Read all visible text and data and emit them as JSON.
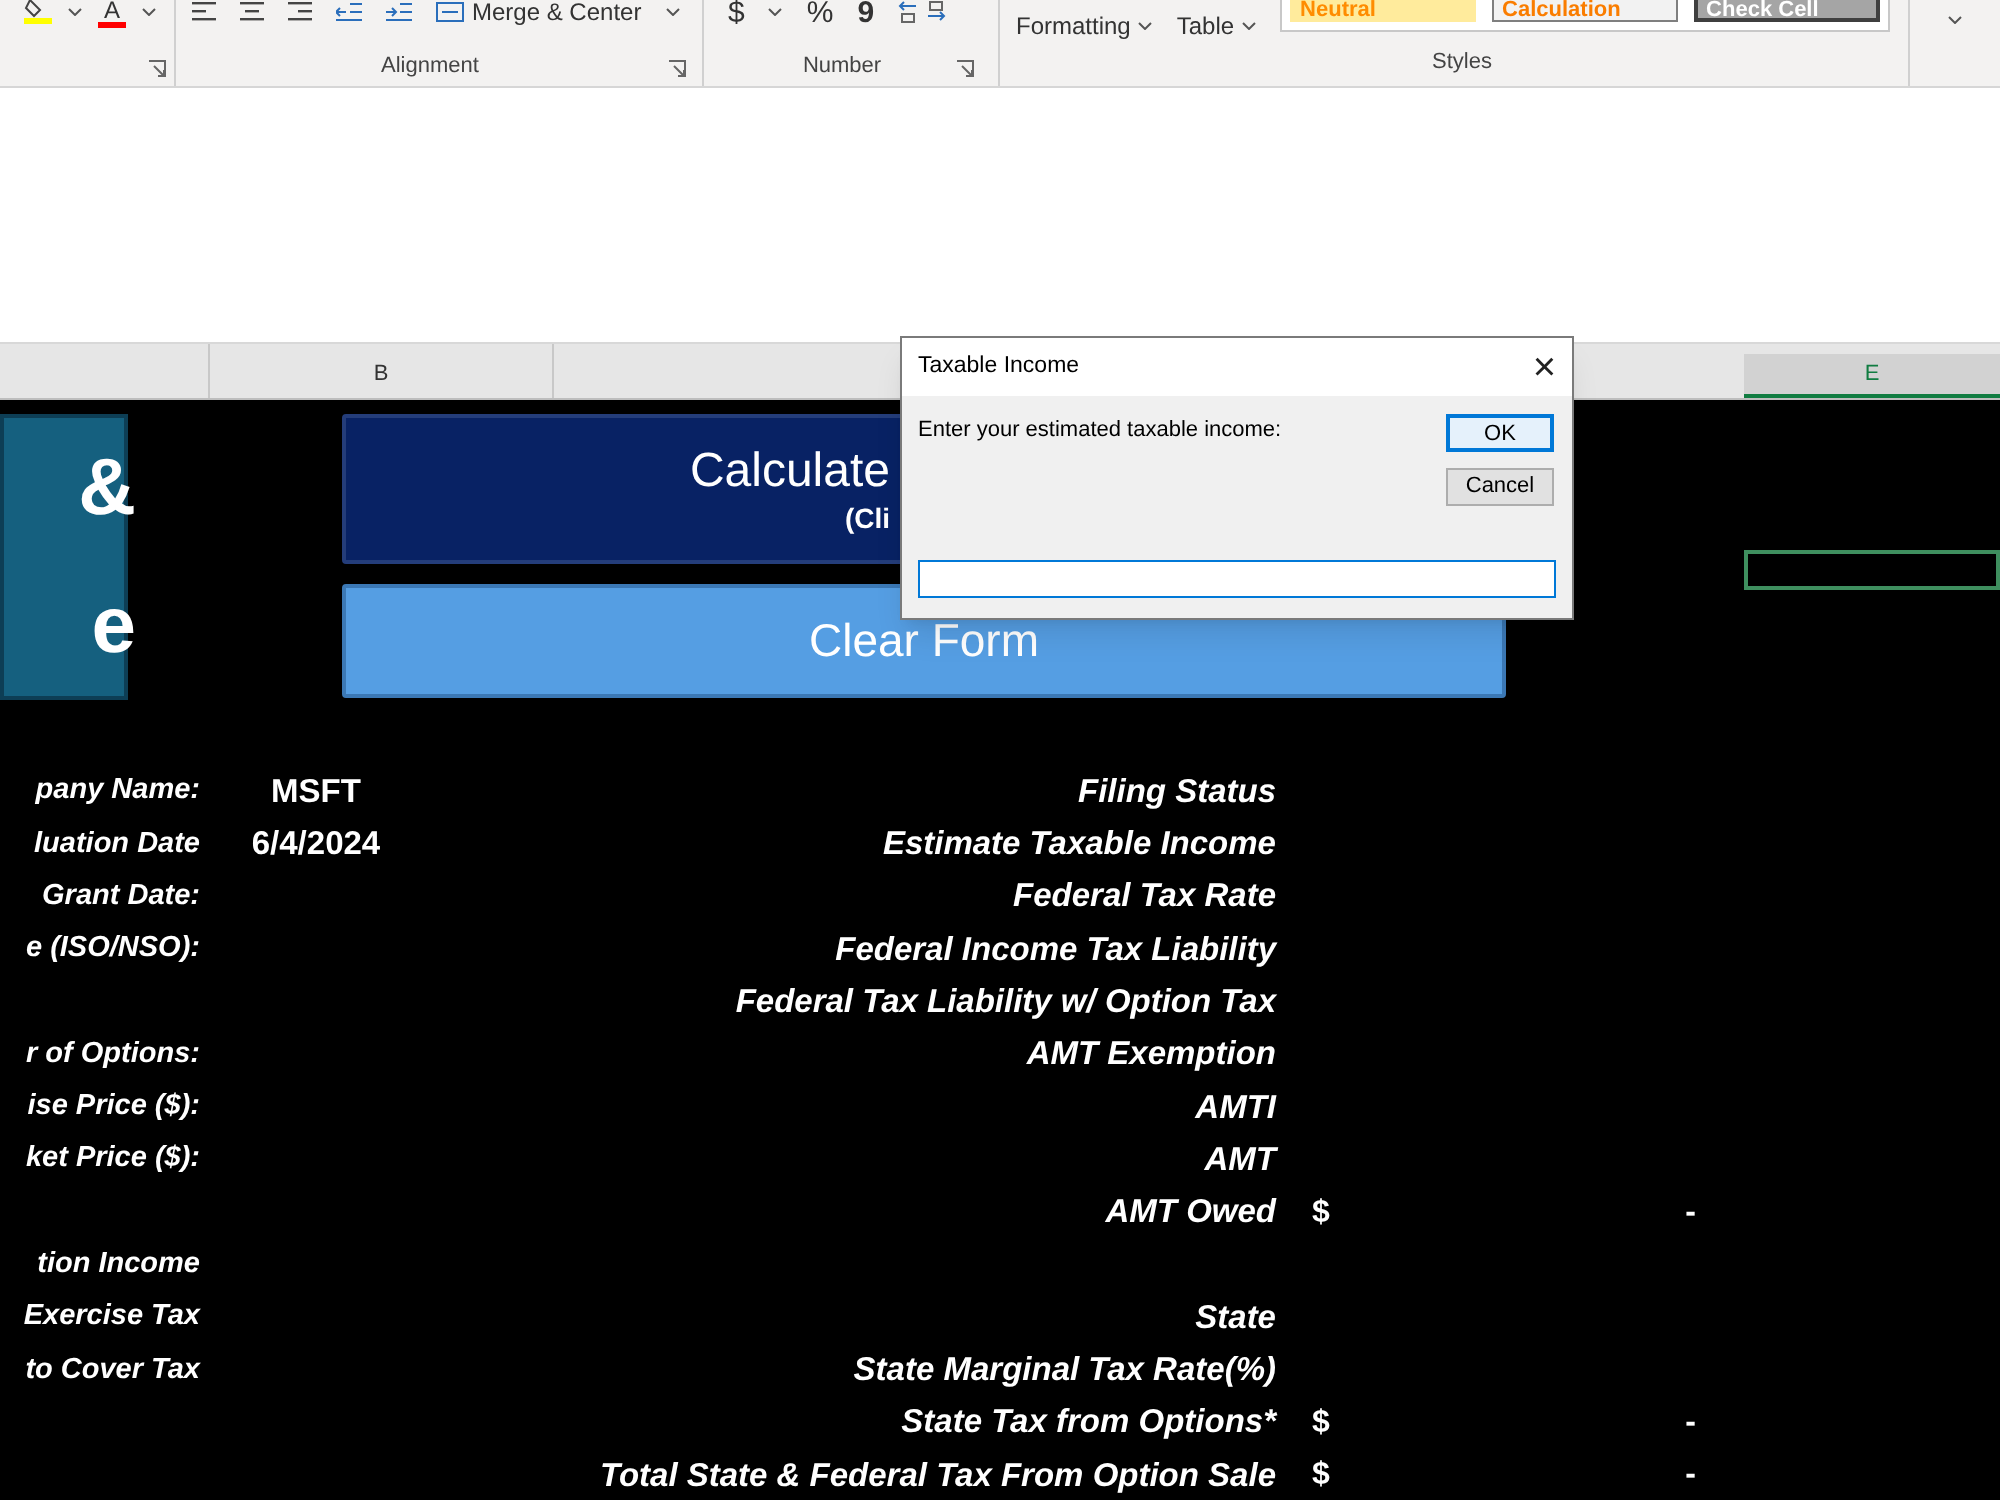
{
  "ribbon": {
    "font_color_letter": "A",
    "merge_button": "Merge & Center",
    "number_symbols": [
      "$",
      "%",
      "9"
    ],
    "conditional_formatting": "Formatting",
    "format_as_table": "Table",
    "cell_styles": [
      {
        "label": "Neutral",
        "kind": "neutral"
      },
      {
        "label": "Calculation",
        "kind": "calculation"
      },
      {
        "label": "Check Cell",
        "kind": "check"
      }
    ],
    "groups": [
      "Alignment",
      "Number",
      "Styles"
    ]
  },
  "column_headers": [
    {
      "label": "B",
      "selected": false
    },
    {
      "label": "E",
      "selected": true
    }
  ],
  "logo_tile": [
    "&",
    "e"
  ],
  "calculate_button": {
    "title": "Calculate",
    "subtitle": "(Cli"
  },
  "clear_button": "Clear Form",
  "rows": [
    {
      "left": "pany Name:",
      "value": "MSFT",
      "right": "Filing Status"
    },
    {
      "left": "luation Date",
      "value": "6/4/2024",
      "right": "Estimate Taxable Income"
    },
    {
      "left": "Grant Date:",
      "right": "Federal Tax Rate"
    },
    {
      "left": "e (ISO/NSO):",
      "right": "Federal Income Tax Liability"
    },
    {
      "right": "Federal  Tax Liability w/ Option Tax"
    },
    {
      "left": "r of Options:",
      "right": "AMT Exemption"
    },
    {
      "left": "ise Price ($):",
      "right": "AMTI"
    },
    {
      "left": "ket Price ($):",
      "right": "AMT"
    },
    {
      "right": "AMT Owed",
      "currency": "$",
      "amount": "-"
    },
    {
      "left": "tion Income"
    },
    {
      "left": "Exercise Tax",
      "right": "State"
    },
    {
      "left": "to Cover Tax",
      "right": "State Marginal Tax Rate(%)"
    },
    {
      "right": "State Tax from Options*",
      "currency": "$",
      "amount": "-"
    },
    {
      "right": "Total State & Federal Tax From Option Sale",
      "currency": "$",
      "amount": "-"
    }
  ],
  "dialog": {
    "title": "Taxable Income",
    "close": "×",
    "prompt": "Enter your estimated taxable income:",
    "buttons": [
      {
        "label": "OK",
        "selected": true
      },
      {
        "label": "Cancel",
        "selected": false
      }
    ]
  }
}
